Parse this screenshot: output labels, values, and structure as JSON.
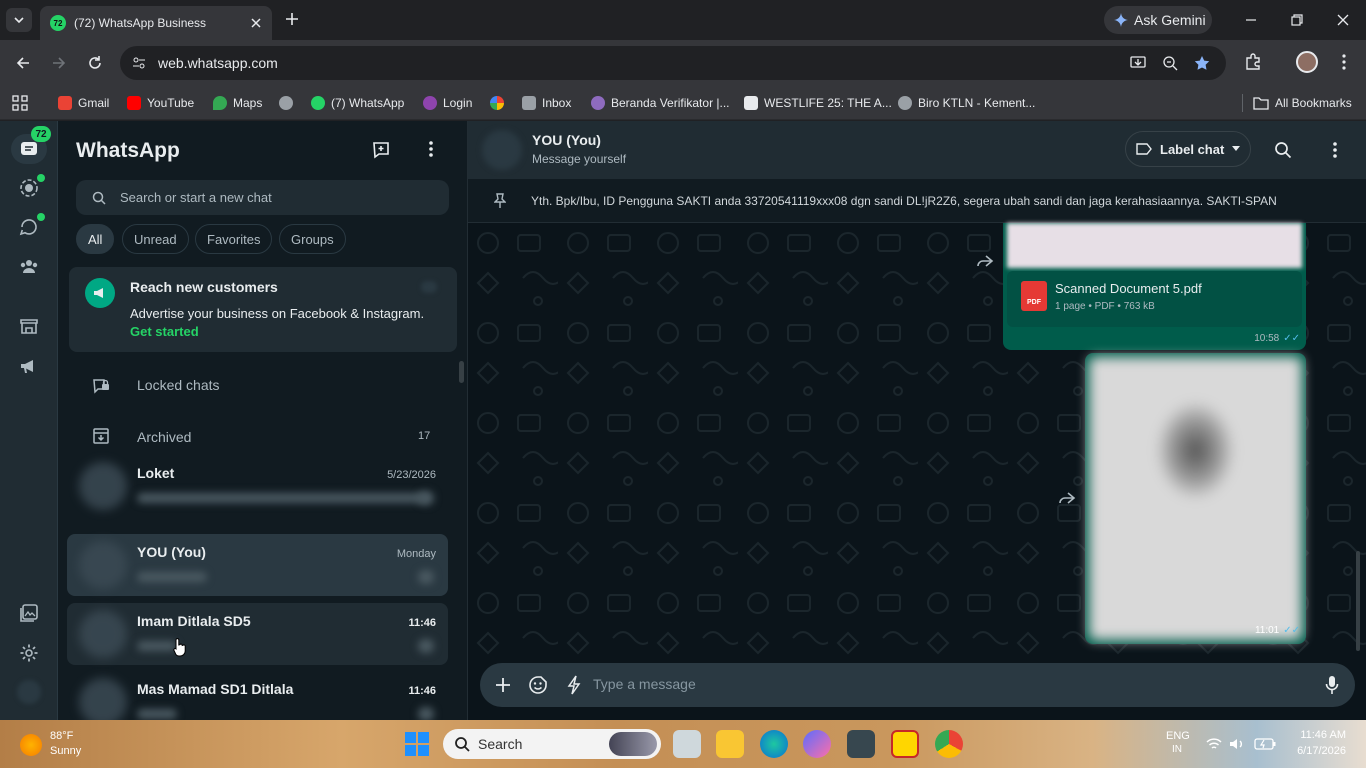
{
  "browser": {
    "tab_title": "(72) WhatsApp Business",
    "tab_favicon_badge": "72",
    "url": "web.whatsapp.com",
    "ask_gemini": "Ask Gemini",
    "bookmarks": [
      {
        "label": "Gmail",
        "icon": "gmail-icon",
        "color": "#ea4335"
      },
      {
        "label": "YouTube",
        "icon": "youtube-icon",
        "color": "#ff0000"
      },
      {
        "label": "Maps",
        "icon": "maps-icon",
        "color": "#34a853"
      },
      {
        "label": "",
        "icon": "globe-icon",
        "color": "#9aa0a6"
      },
      {
        "label": "(7) WhatsApp",
        "icon": "whatsapp-icon",
        "color": "#25d366"
      },
      {
        "label": "Login",
        "icon": "login-site-icon",
        "color": "#8e44ad"
      },
      {
        "label": "",
        "icon": "photos-icon",
        "color": "#fbbc04"
      },
      {
        "label": "Inbox",
        "icon": "mail-icon",
        "color": "#9aa0a6"
      },
      {
        "label": "Beranda Verifikator |...",
        "icon": "site-icon",
        "color": "#8e6bbf"
      },
      {
        "label": "WESTLIFE 25: THE A...",
        "icon": "site-icon",
        "color": "#e8eaed"
      },
      {
        "label": "Biro KTLN - Kement...",
        "icon": "globe-icon",
        "color": "#9aa0a6"
      }
    ],
    "all_bookmarks": "All Bookmarks"
  },
  "rail": {
    "chats_badge": "72"
  },
  "chatlist": {
    "title": "WhatsApp",
    "search_placeholder": "Search or start a new chat",
    "filters": [
      "All",
      "Unread",
      "Favorites",
      "Groups"
    ],
    "promo": {
      "title": "Reach new customers",
      "body": "Advertise your business on Facebook & Instagram.",
      "cta": "Get started"
    },
    "locked_chats": "Locked chats",
    "archived": "Archived",
    "archived_count": "17",
    "chats": [
      {
        "name": "Loket",
        "time": "5/23/2026",
        "bold_time": false
      },
      {
        "name": "YOU (You)",
        "time": "Monday",
        "bold_time": false
      },
      {
        "name": "Imam Ditlala SD5",
        "time": "11:46",
        "bold_time": true
      },
      {
        "name": "Mas Mamad SD1 Ditlala",
        "time": "11:46",
        "bold_time": true
      }
    ]
  },
  "conversation": {
    "name": "YOU (You)",
    "subtitle": "Message yourself",
    "label_chat": "Label chat",
    "pinned_text": "Yth. Bpk/Ibu, ID Pengguna SAKTI anda 33720541119xxx08 dgn sandi DL!jR2Z6, segera ubah sandi dan jaga kerahasiaannya. SAKTI-SPAN",
    "doc": {
      "badge": "PDF",
      "filename": "Scanned Document 5.pdf",
      "meta": "1 page • PDF • 763 kB",
      "time": "10:58"
    },
    "image_msg_time": "11:01",
    "input_placeholder": "Type a message"
  },
  "taskbar": {
    "weather_temp": "88°F",
    "weather_desc": "Sunny",
    "search": "Search",
    "lang": "ENG",
    "lang_sub": "IN",
    "time": "11:46 AM",
    "date": "6/17/2026"
  }
}
